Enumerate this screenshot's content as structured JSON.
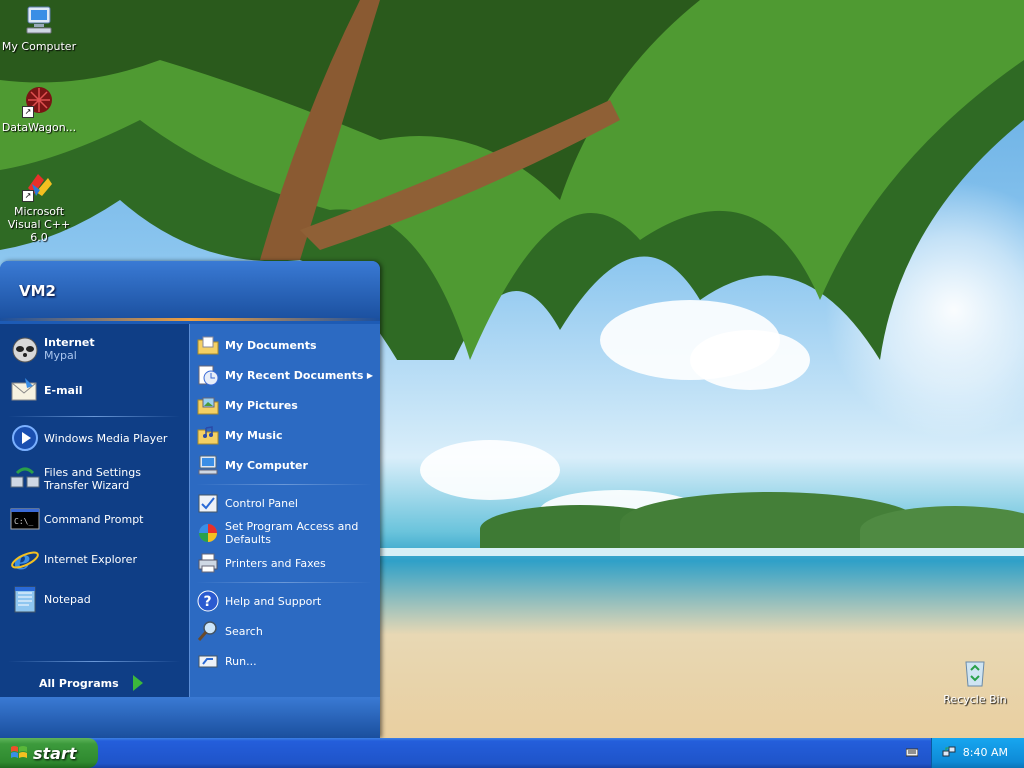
{
  "desktop": {
    "icons": [
      {
        "label": "My Computer"
      },
      {
        "label": "DataWagon..."
      },
      {
        "label": "Microsoft Visual C++ 6.0"
      },
      {
        "label": "Recycle Bin"
      }
    ]
  },
  "start_menu": {
    "user_name": "VM2",
    "pinned": [
      {
        "title": "Internet",
        "subtitle": "Mypal"
      },
      {
        "title": "E-mail"
      }
    ],
    "recent": [
      {
        "label": "Windows Media Player"
      },
      {
        "label": "Files and Settings Transfer Wizard"
      },
      {
        "label": "Command Prompt"
      },
      {
        "label": "Internet Explorer"
      },
      {
        "label": "Notepad"
      }
    ],
    "all_programs": "All Programs",
    "places": [
      {
        "label": "My Documents"
      },
      {
        "label": "My Recent Documents"
      },
      {
        "label": "My Pictures"
      },
      {
        "label": "My Music"
      },
      {
        "label": "My Computer"
      }
    ],
    "settings": [
      {
        "label": "Control Panel"
      },
      {
        "label": "Set Program Access and Defaults"
      },
      {
        "label": "Printers and Faxes"
      }
    ],
    "help": [
      {
        "label": "Help and Support"
      },
      {
        "label": "Search"
      },
      {
        "label": "Run..."
      }
    ]
  },
  "taskbar": {
    "start_label": "start",
    "clock": "8:40 AM"
  }
}
